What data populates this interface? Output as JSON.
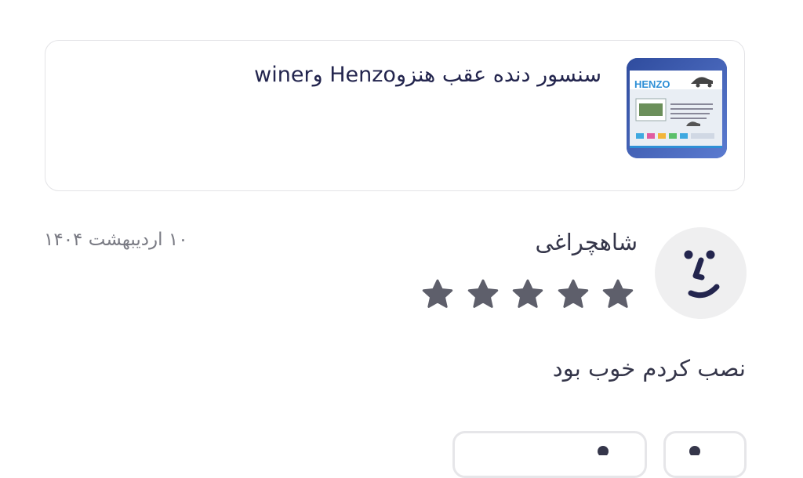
{
  "product": {
    "title": "سنسور دنده عقب هنزوHenzo وwiner",
    "image_alt": "HENZO",
    "box_brand_text": "HENZO"
  },
  "review": {
    "reviewer_name": "شاهچراغی",
    "date": "۱۰ اردیبهشت ۱۴۰۴",
    "rating": 5,
    "rating_max": 5,
    "text": "نصب کردم خوب بود"
  },
  "colors": {
    "primary_text": "#23254e",
    "star": "#5e5f6b",
    "secondary_text": "#7a7b84",
    "card_border": "#e3e3e6",
    "avatar_bg": "#efeff0"
  },
  "icons": {
    "avatar": "face-icon",
    "star": "star-icon",
    "chip_left": "like-icon",
    "chip_right": "dislike-icon"
  }
}
